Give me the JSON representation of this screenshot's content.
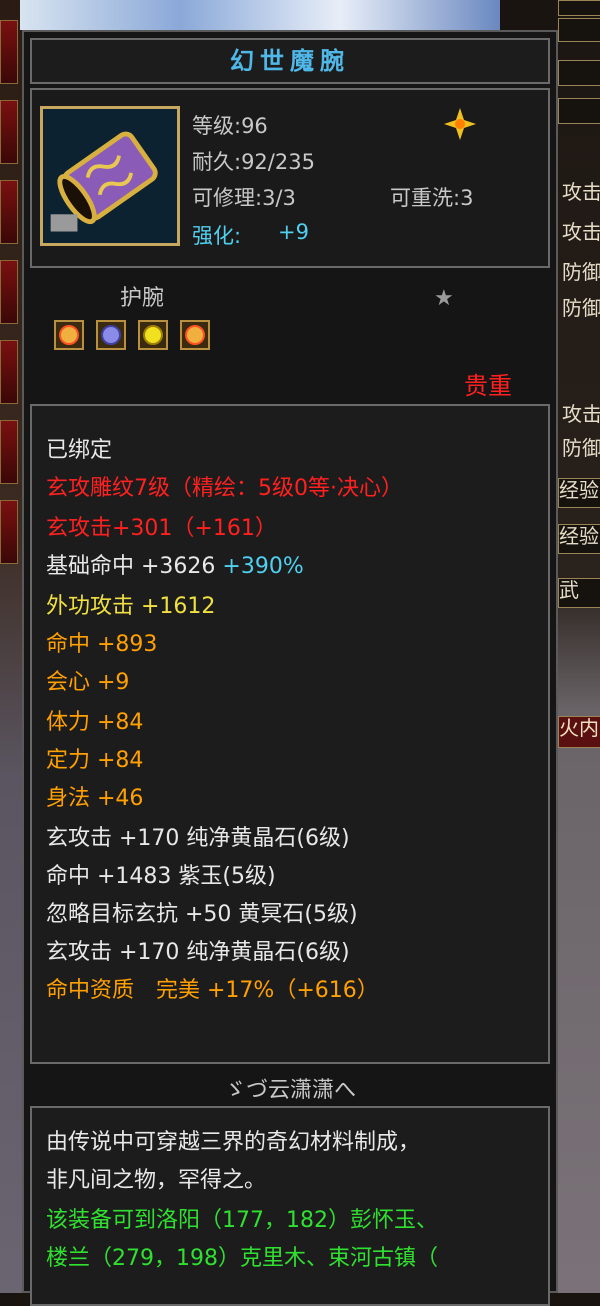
{
  "item": {
    "name": "幻世魔腕",
    "level": "等级:96",
    "durability": "耐久:92/235",
    "repairable": "可修理:3/3",
    "rewash": "可重洗:3",
    "enhance_label": "强化:",
    "enhance_value": "+9",
    "type": "护腕",
    "rarity": "贵重"
  },
  "attributes": {
    "bound": "已绑定",
    "engrave": "玄攻雕纹7级（精绘：5级0等·决心）",
    "xuan_attack": "玄攻击+301（+161）",
    "base_hit_label": "基础命中 +3626",
    "base_hit_pct": "+390%",
    "outer_attack": "外功攻击 +1612",
    "hit": "命中 +893",
    "crit": "会心 +9",
    "stamina": "体力 +84",
    "focus": "定力 +84",
    "agility": "身法 +46",
    "gem1": "玄攻击 +170 纯净黄晶石(6级)",
    "gem2": "命中 +1483 紫玉(5级)",
    "gem3": "忽略目标玄抗 +50 黄冥石(5级)",
    "gem4": "玄攻击 +170 纯净黄晶石(6级)",
    "quality": "命中资质　完美 +17%（+616）"
  },
  "signature": "ゞづ云潇潇へ",
  "description": {
    "line1": "由传说中可穿越三界的奇幻材料制成，",
    "line2": "非凡间之物，罕得之。",
    "line3": "该装备可到洛阳（177，182）彭怀玉、",
    "line4": "楼兰（279，198）克里木、束河古镇（"
  },
  "side_panel": {
    "r1": "攻击",
    "r2": "攻击",
    "r3": "防御",
    "r4": "防御",
    "r5": "攻击",
    "r6": "防御",
    "r7": "经验",
    "r8": "经验",
    "r9": "武",
    "r10": "火内"
  },
  "colors": {
    "title": "#4fb8e8",
    "rarity": "#ff2020",
    "attribute_yellow": "#f0e040",
    "attribute_orange": "#ffa000",
    "description_green": "#30e030"
  }
}
